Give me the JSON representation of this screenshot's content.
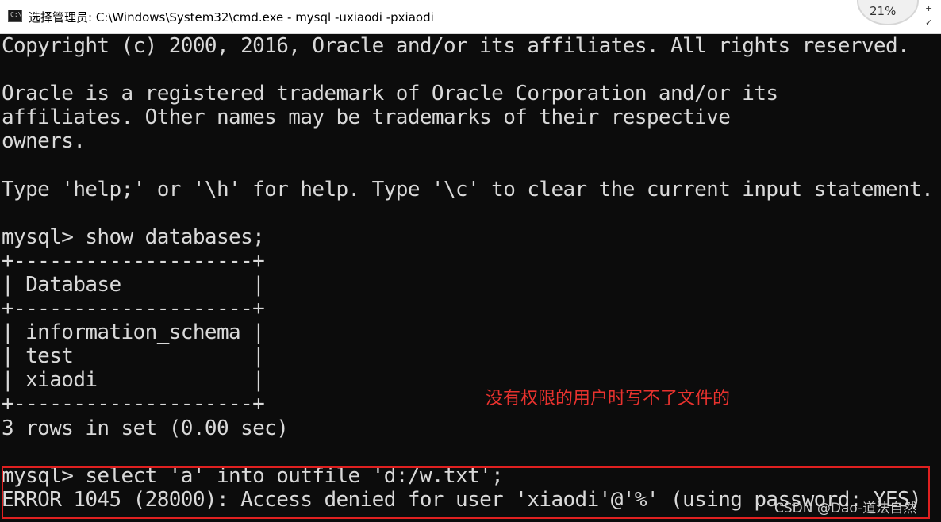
{
  "window": {
    "title": "选择管理员: C:\\Windows\\System32\\cmd.exe - mysql  -uxiaodi -pxiaodi",
    "app_icon_text": "C:\\",
    "zoom_text": "21%",
    "buttons": [
      "+",
      "✓"
    ]
  },
  "console": {
    "lines": [
      "Copyright (c) 2000, 2016, Oracle and/or its affiliates. All rights reserved.",
      "Oracle is a registered trademark of Oracle Corporation and/or its",
      "affiliates. Other names may be trademarks of their respective",
      "owners.",
      "Type 'help;' or '\\h' for help. Type '\\c' to clear the current input statement.",
      "mysql> show databases;",
      "+--------------------+",
      "| Database           |",
      "+--------------------+",
      "| information_schema |",
      "| test               |",
      "| xiaodi             |",
      "+--------------------+",
      "3 rows in set (0.00 sec)",
      "mysql> select 'a' into outfile 'd:/w.txt';",
      "ERROR 1045 (28000): Access denied for user 'xiaodi'@'%' (using password: YES)"
    ]
  },
  "annotation": {
    "text": "没有权限的用户时写不了文件的",
    "color": "#e8322e"
  },
  "watermark": "CSDN @Dao-道法自然",
  "colors": {
    "console_bg": "#0c0c0c",
    "console_fg": "#d9d9d9",
    "highlight": "#e02020"
  }
}
